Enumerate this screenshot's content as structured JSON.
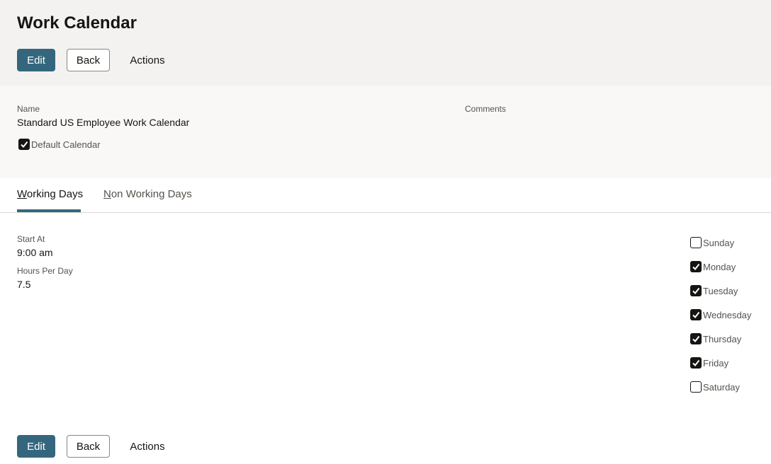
{
  "header": {
    "title": "Work Calendar",
    "edit_label": "Edit",
    "back_label": "Back",
    "actions_label": "Actions"
  },
  "details": {
    "name_label": "Name",
    "name_value": "Standard US Employee Work Calendar",
    "comments_label": "Comments",
    "default_calendar_label": "Default Calendar",
    "default_calendar_checked": true
  },
  "tabs": [
    {
      "mnemonic": "W",
      "rest": "orking Days",
      "active": true
    },
    {
      "mnemonic": "N",
      "rest": "on Working Days",
      "active": false
    }
  ],
  "working_days": {
    "start_at_label": "Start At",
    "start_at_value": "9:00 am",
    "hours_label": "Hours Per Day",
    "hours_value": "7.5",
    "days": [
      {
        "label": "Sunday",
        "checked": false
      },
      {
        "label": "Monday",
        "checked": true
      },
      {
        "label": "Tuesday",
        "checked": true
      },
      {
        "label": "Wednesday",
        "checked": true
      },
      {
        "label": "Thursday",
        "checked": true
      },
      {
        "label": "Friday",
        "checked": true
      },
      {
        "label": "Saturday",
        "checked": false
      }
    ]
  },
  "footer": {
    "edit_label": "Edit",
    "back_label": "Back",
    "actions_label": "Actions"
  },
  "colors": {
    "primary": "#34677e",
    "header_bg": "#f4f2f0",
    "details_bg": "#f9f8f6"
  }
}
